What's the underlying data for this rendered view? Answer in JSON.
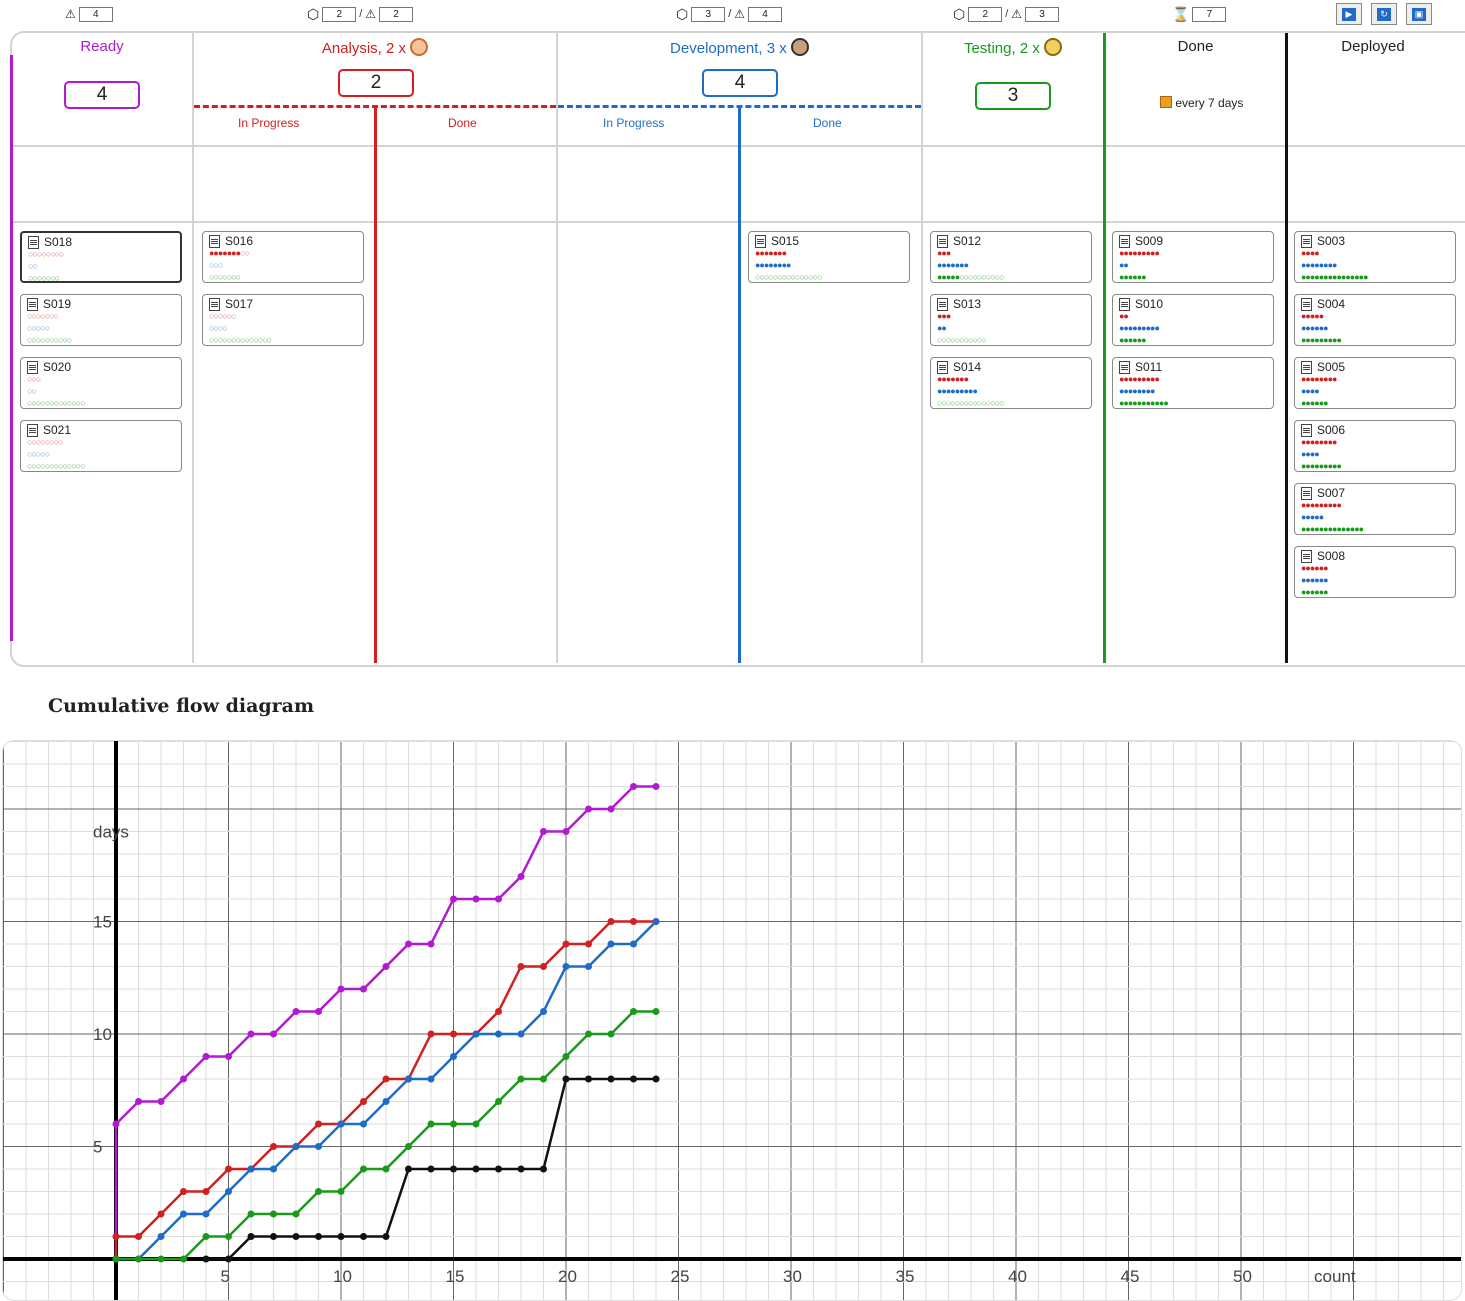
{
  "controls": {
    "ready_limit": "4",
    "analysis_dice": "2",
    "analysis_limit": "2",
    "development_dice": "3",
    "development_limit": "4",
    "testing_dice": "2",
    "testing_limit": "3",
    "deploy_interval": "7",
    "icons": [
      "warning-icon",
      "dice-icon",
      "hourglass-icon",
      "play-icon",
      "step-icon",
      "reset-icon"
    ]
  },
  "columns": {
    "ready": {
      "title": "Ready",
      "wip": "4",
      "color": "#b21ad1"
    },
    "analysis": {
      "title": "Analysis, 2 x",
      "wip": "2",
      "color": "#d02020",
      "sub_in_progress": "In Progress",
      "sub_done": "Done"
    },
    "development": {
      "title": "Development, 3 x",
      "wip": "4",
      "color": "#1e6cc8",
      "sub_in_progress": "In Progress",
      "sub_done": "Done"
    },
    "testing": {
      "title": "Testing, 2 x",
      "wip": "3",
      "color": "#1a9a1a"
    },
    "done": {
      "title": "Done",
      "cadence": "every 7 days",
      "color": "#1a9a1a"
    },
    "deployed": {
      "title": "Deployed",
      "color": "#111111"
    }
  },
  "cards": {
    "ready": [
      {
        "id": "S018",
        "r": [
          0,
          8
        ],
        "b": [
          0,
          2
        ],
        "g": [
          0,
          7
        ]
      },
      {
        "id": "S019",
        "r": [
          0,
          7
        ],
        "b": [
          0,
          5
        ],
        "g": [
          0,
          10
        ]
      },
      {
        "id": "S020",
        "r": [
          0,
          3
        ],
        "b": [
          0,
          2
        ],
        "g": [
          0,
          13
        ]
      },
      {
        "id": "S021",
        "r": [
          0,
          8
        ],
        "b": [
          0,
          5
        ],
        "g": [
          0,
          13
        ]
      }
    ],
    "analysis_in_progress": [
      {
        "id": "S016",
        "r": [
          7,
          2
        ],
        "b": [
          0,
          3
        ],
        "g": [
          0,
          7
        ]
      },
      {
        "id": "S017",
        "r": [
          0,
          6
        ],
        "b": [
          0,
          4
        ],
        "g": [
          0,
          14
        ]
      }
    ],
    "development_in_progress": [
      {
        "id": "S015",
        "r": [
          7,
          0
        ],
        "b": [
          8,
          0
        ],
        "g": [
          0,
          15
        ]
      }
    ],
    "testing": [
      {
        "id": "S012",
        "r": [
          3,
          0
        ],
        "b": [
          7,
          0
        ],
        "g": [
          5,
          10
        ]
      },
      {
        "id": "S013",
        "r": [
          3,
          0
        ],
        "b": [
          2,
          0
        ],
        "g": [
          0,
          11
        ]
      },
      {
        "id": "S014",
        "r": [
          7,
          0
        ],
        "b": [
          9,
          0
        ],
        "g": [
          0,
          15
        ]
      }
    ],
    "done": [
      {
        "id": "S009",
        "r": [
          9,
          0
        ],
        "b": [
          2,
          0
        ],
        "g": [
          6,
          0
        ]
      },
      {
        "id": "S010",
        "r": [
          2,
          0
        ],
        "b": [
          9,
          0
        ],
        "g": [
          6,
          0
        ]
      },
      {
        "id": "S011",
        "r": [
          9,
          0
        ],
        "b": [
          8,
          0
        ],
        "g": [
          11,
          0
        ]
      }
    ],
    "deployed": [
      {
        "id": "S003",
        "r": [
          4,
          0
        ],
        "b": [
          8,
          0
        ],
        "g": [
          15,
          0
        ]
      },
      {
        "id": "S004",
        "r": [
          5,
          0
        ],
        "b": [
          6,
          0
        ],
        "g": [
          9,
          0
        ]
      },
      {
        "id": "S005",
        "r": [
          8,
          0
        ],
        "b": [
          4,
          0
        ],
        "g": [
          6,
          0
        ]
      },
      {
        "id": "S006",
        "r": [
          8,
          0
        ],
        "b": [
          4,
          0
        ],
        "g": [
          9,
          0
        ]
      },
      {
        "id": "S007",
        "r": [
          9,
          0
        ],
        "b": [
          5,
          0
        ],
        "g": [
          14,
          0
        ]
      },
      {
        "id": "S008",
        "r": [
          6,
          0
        ],
        "b": [
          6,
          0
        ],
        "g": [
          6,
          0
        ]
      }
    ]
  },
  "cfd": {
    "title": "Cumulative flow diagram",
    "x_label": "count",
    "y_label": "days",
    "x_ticks": [
      5,
      10,
      15,
      20,
      25,
      30,
      35,
      40,
      45,
      50
    ],
    "y_ticks": [
      5,
      10,
      15
    ],
    "chart_data": {
      "type": "line",
      "xlim": [
        -5,
        60
      ],
      "ylim": [
        -2,
        23
      ],
      "series": [
        {
          "color": "#b21ad1",
          "points": [
            [
              0,
              0
            ],
            [
              0,
              6
            ],
            [
              1,
              7
            ],
            [
              2,
              7
            ],
            [
              3,
              8
            ],
            [
              4,
              9
            ],
            [
              5,
              9
            ],
            [
              6,
              10
            ],
            [
              7,
              10
            ],
            [
              8,
              11
            ],
            [
              9,
              11
            ],
            [
              10,
              12
            ],
            [
              11,
              12
            ],
            [
              12,
              13
            ],
            [
              13,
              14
            ],
            [
              14,
              14
            ],
            [
              15,
              16
            ],
            [
              16,
              16
            ],
            [
              17,
              16
            ],
            [
              18,
              17
            ],
            [
              19,
              19
            ],
            [
              20,
              19
            ],
            [
              21,
              20
            ],
            [
              22,
              20
            ],
            [
              23,
              21
            ],
            [
              24,
              21
            ]
          ]
        },
        {
          "color": "#d02020",
          "points": [
            [
              0,
              0
            ],
            [
              0,
              1
            ],
            [
              1,
              1
            ],
            [
              2,
              2
            ],
            [
              3,
              3
            ],
            [
              4,
              3
            ],
            [
              5,
              4
            ],
            [
              6,
              4
            ],
            [
              7,
              5
            ],
            [
              8,
              5
            ],
            [
              9,
              6
            ],
            [
              10,
              6
            ],
            [
              11,
              7
            ],
            [
              12,
              8
            ],
            [
              13,
              8
            ],
            [
              14,
              10
            ],
            [
              15,
              10
            ],
            [
              16,
              10
            ],
            [
              17,
              11
            ],
            [
              18,
              13
            ],
            [
              19,
              13
            ],
            [
              20,
              14
            ],
            [
              21,
              14
            ],
            [
              22,
              15
            ],
            [
              23,
              15
            ],
            [
              24,
              15
            ]
          ]
        },
        {
          "color": "#1e6cc8",
          "points": [
            [
              0,
              0
            ],
            [
              1,
              0
            ],
            [
              2,
              1
            ],
            [
              3,
              2
            ],
            [
              4,
              2
            ],
            [
              5,
              3
            ],
            [
              6,
              4
            ],
            [
              7,
              4
            ],
            [
              8,
              5
            ],
            [
              9,
              5
            ],
            [
              10,
              6
            ],
            [
              11,
              6
            ],
            [
              12,
              7
            ],
            [
              13,
              8
            ],
            [
              14,
              8
            ],
            [
              15,
              9
            ],
            [
              16,
              10
            ],
            [
              17,
              10
            ],
            [
              18,
              10
            ],
            [
              19,
              11
            ],
            [
              20,
              13
            ],
            [
              21,
              13
            ],
            [
              22,
              14
            ],
            [
              23,
              14
            ],
            [
              24,
              15
            ]
          ]
        },
        {
          "color": "#1a9a1a",
          "points": [
            [
              0,
              0
            ],
            [
              1,
              0
            ],
            [
              2,
              0
            ],
            [
              3,
              0
            ],
            [
              4,
              1
            ],
            [
              5,
              1
            ],
            [
              6,
              2
            ],
            [
              7,
              2
            ],
            [
              8,
              2
            ],
            [
              9,
              3
            ],
            [
              10,
              3
            ],
            [
              11,
              4
            ],
            [
              12,
              4
            ],
            [
              13,
              5
            ],
            [
              14,
              6
            ],
            [
              15,
              6
            ],
            [
              16,
              6
            ],
            [
              17,
              7
            ],
            [
              18,
              8
            ],
            [
              19,
              8
            ],
            [
              20,
              9
            ],
            [
              21,
              10
            ],
            [
              22,
              10
            ],
            [
              23,
              11
            ],
            [
              24,
              11
            ]
          ]
        },
        {
          "color": "#111111",
          "points": [
            [
              4,
              0
            ],
            [
              5,
              0
            ],
            [
              6,
              1
            ],
            [
              7,
              1
            ],
            [
              8,
              1
            ],
            [
              9,
              1
            ],
            [
              10,
              1
            ],
            [
              11,
              1
            ],
            [
              12,
              1
            ],
            [
              13,
              4
            ],
            [
              14,
              4
            ],
            [
              15,
              4
            ],
            [
              16,
              4
            ],
            [
              17,
              4
            ],
            [
              18,
              4
            ],
            [
              19,
              4
            ],
            [
              20,
              8
            ],
            [
              21,
              8
            ],
            [
              22,
              8
            ],
            [
              23,
              8
            ],
            [
              24,
              8
            ]
          ]
        }
      ]
    }
  }
}
